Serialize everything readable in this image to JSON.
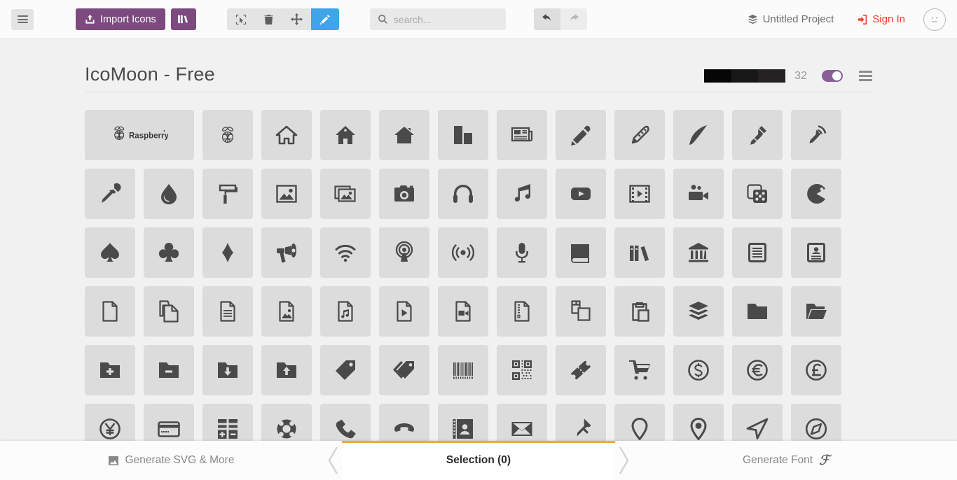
{
  "toolbar": {
    "menu_button": "menu-icon",
    "import_label": "Import Icons",
    "import_icon": "upload-icon",
    "library_icon": "library-icon",
    "tools": [
      {
        "name": "select-tool",
        "icon": "cursor-select-icon",
        "active": false
      },
      {
        "name": "delete-tool",
        "icon": "trash-icon",
        "active": false
      },
      {
        "name": "move-tool",
        "icon": "move-icon",
        "active": false
      },
      {
        "name": "edit-tool",
        "icon": "pencil-icon",
        "active": true
      }
    ],
    "search": {
      "value": "",
      "placeholder": "search..."
    },
    "undo_icon": "undo-arrow-icon",
    "redo_icon": "redo-arrow-icon",
    "project_name": "Untitled Project",
    "project_icon": "stack-icon",
    "sign_in_label": "Sign In",
    "sign_in_icon": "login-icon",
    "avatar_icon": "neutral-face-icon"
  },
  "set": {
    "title": "IcoMoon - Free",
    "grid_size": "32",
    "slider_colors": [
      "#060606",
      "#171717",
      "#252224"
    ],
    "toggle_on": true,
    "toggle_color": "#8b5f96",
    "menu_icon": "set-menu-icon"
  },
  "icons": [
    {
      "name": "raspberry-pi-logo",
      "wide": true
    },
    {
      "name": "raspberry-pi-icon"
    },
    {
      "name": "home-icon"
    },
    {
      "name": "home2-icon"
    },
    {
      "name": "home3-icon"
    },
    {
      "name": "office-icon"
    },
    {
      "name": "newspaper-icon"
    },
    {
      "name": "pencil-icon"
    },
    {
      "name": "pencil2-icon"
    },
    {
      "name": "quill-icon"
    },
    {
      "name": "pen-icon"
    },
    {
      "name": "blog-icon"
    },
    {
      "name": "eyedropper-icon"
    },
    {
      "name": "droplet-icon"
    },
    {
      "name": "paint-format-icon"
    },
    {
      "name": "image-icon"
    },
    {
      "name": "images-icon"
    },
    {
      "name": "camera-icon"
    },
    {
      "name": "headphones-icon"
    },
    {
      "name": "music-icon"
    },
    {
      "name": "play-icon"
    },
    {
      "name": "film-icon"
    },
    {
      "name": "video-camera-icon"
    },
    {
      "name": "dice-icon"
    },
    {
      "name": "pacman-icon"
    },
    {
      "name": "spades-icon"
    },
    {
      "name": "clubs-icon"
    },
    {
      "name": "diamonds-icon"
    },
    {
      "name": "bullhorn-icon"
    },
    {
      "name": "connection-icon"
    },
    {
      "name": "podcast-icon"
    },
    {
      "name": "feed-icon"
    },
    {
      "name": "mic-icon"
    },
    {
      "name": "book-icon"
    },
    {
      "name": "books-icon"
    },
    {
      "name": "library-icon"
    },
    {
      "name": "file-text-icon"
    },
    {
      "name": "profile-icon"
    },
    {
      "name": "file-empty-icon"
    },
    {
      "name": "files-empty-icon"
    },
    {
      "name": "file-text2-icon"
    },
    {
      "name": "file-picture-icon"
    },
    {
      "name": "file-music-icon"
    },
    {
      "name": "file-play-icon"
    },
    {
      "name": "file-video-icon"
    },
    {
      "name": "file-zip-icon"
    },
    {
      "name": "copy-icon"
    },
    {
      "name": "paste-icon"
    },
    {
      "name": "stack-icon"
    },
    {
      "name": "folder-icon"
    },
    {
      "name": "folder-open-icon"
    },
    {
      "name": "folder-plus-icon"
    },
    {
      "name": "folder-minus-icon"
    },
    {
      "name": "folder-download-icon"
    },
    {
      "name": "folder-upload-icon"
    },
    {
      "name": "price-tag-icon"
    },
    {
      "name": "price-tags-icon"
    },
    {
      "name": "barcode-icon"
    },
    {
      "name": "qrcode-icon"
    },
    {
      "name": "ticket-icon"
    },
    {
      "name": "cart-icon"
    },
    {
      "name": "coin-dollar-icon"
    },
    {
      "name": "coin-euro-icon"
    },
    {
      "name": "coin-pound-icon"
    },
    {
      "name": "coin-yen-icon"
    },
    {
      "name": "credit-card-icon"
    },
    {
      "name": "calculator-icon"
    },
    {
      "name": "lifebuoy-icon"
    },
    {
      "name": "phone-icon"
    },
    {
      "name": "phone-hang-up-icon"
    },
    {
      "name": "address-book-icon"
    },
    {
      "name": "envelop-icon"
    },
    {
      "name": "pushpin-icon"
    },
    {
      "name": "location-icon"
    },
    {
      "name": "location2-icon"
    },
    {
      "name": "direction-icon"
    },
    {
      "name": "compass-icon"
    }
  ],
  "bottom_bar": {
    "left_label": "Generate SVG & More",
    "left_icon": "image-icon",
    "center_label": "Selection (0)",
    "right_label": "Generate Font",
    "right_icon": "script-f-icon",
    "accent_color": "#f5a935"
  }
}
